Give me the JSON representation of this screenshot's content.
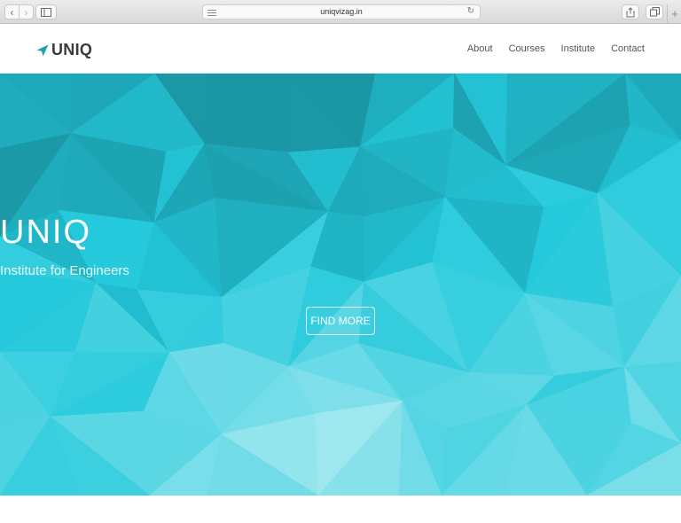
{
  "browser": {
    "url": "uniqvizag.in",
    "back_glyph": "‹",
    "forward_glyph": "›",
    "reload_glyph": "↻",
    "new_tab_glyph": "+"
  },
  "nav": {
    "brand": "UNIQ",
    "brand_icon": "paper-plane-icon",
    "links": [
      "About",
      "Courses",
      "Institute",
      "Contact"
    ]
  },
  "hero": {
    "title": "UNIQ",
    "subtitle": "Institute for Engineers",
    "button": "FIND MORE"
  },
  "colors": {
    "accent": "#1aa6b5",
    "brand_icon": "#1f9fb0",
    "nav_text": "#555555"
  }
}
